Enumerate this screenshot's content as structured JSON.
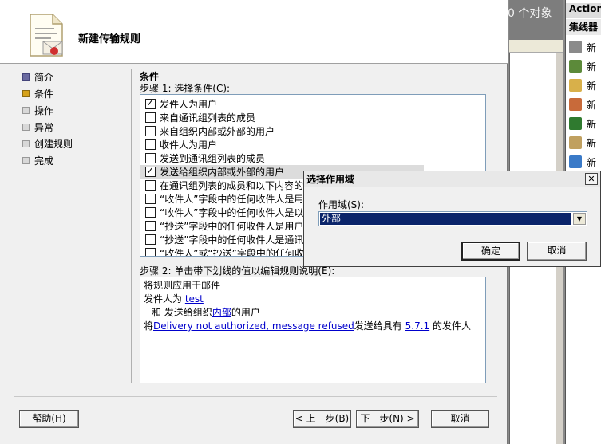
{
  "background": {
    "object_count_text": "0 个对象",
    "actions_header": "Actions",
    "actions_subheader": "集线器",
    "actions_items": [
      {
        "label": "新",
        "icon": "hub-icon",
        "color": "#8a8a8a"
      },
      {
        "label": "新",
        "icon": "connector-icon",
        "color": "#5c8a3a"
      },
      {
        "label": "新",
        "icon": "document-icon",
        "color": "#d8b04a"
      },
      {
        "label": "新",
        "icon": "mail-rule-icon",
        "color": "#c86a3a"
      },
      {
        "label": "新",
        "icon": "book-icon",
        "color": "#2f7a2f"
      },
      {
        "label": "新",
        "icon": "user-icon",
        "color": "#c0a060"
      },
      {
        "label": "新",
        "icon": "globe-icon",
        "color": "#3a7ac8"
      }
    ]
  },
  "wizard": {
    "title": "新建传输规则",
    "nav": [
      {
        "label": "简介",
        "state": "done"
      },
      {
        "label": "条件",
        "state": "current"
      },
      {
        "label": "操作",
        "state": "pending"
      },
      {
        "label": "异常",
        "state": "pending"
      },
      {
        "label": "创建规则",
        "state": "pending"
      },
      {
        "label": "完成",
        "state": "pending"
      }
    ],
    "conditions_heading": "条件",
    "step1_label": "步骤 1: 选择条件(C):",
    "conditions": [
      {
        "label": "发件人为用户",
        "checked": true
      },
      {
        "label": "来自通讯组列表的成员",
        "checked": false
      },
      {
        "label": "来自组织内部或外部的用户",
        "checked": false
      },
      {
        "label": "收件人为用户",
        "checked": false
      },
      {
        "label": "发送到通讯组列表的成员",
        "checked": false
      },
      {
        "label": "发送给组织内部或外部的用户",
        "checked": true,
        "selected": true
      },
      {
        "label": "在通讯组列表的成员和以下内容的",
        "checked": false
      },
      {
        "label": "“收件人”字段中的任何收件人是用",
        "checked": false
      },
      {
        "label": "“收件人”字段中的任何收件人是以",
        "checked": false
      },
      {
        "label": "“抄送”字段中的任何收件人是用户",
        "checked": false
      },
      {
        "label": "“抄送”字段中的任何收件人是通讯",
        "checked": false
      },
      {
        "label": "“收件人”或“抄送”字段中的任何收件",
        "checked": false
      }
    ],
    "step2_label": "步骤 2: 单击带下划线的值以编辑规则说明(E):",
    "description": {
      "line1": "将规则应用于邮件",
      "line2_prefix": "发件人为 ",
      "line2_link": "test",
      "line3_prefix": "和 发送给组织",
      "line3_link": "内部",
      "line3_suffix": "的用户",
      "line4_prefix": "将",
      "line4_link1": "Delivery not authorized, message refused",
      "line4_mid": "发送给具有 ",
      "line4_link2": "5.7.1",
      "line4_suffix": " 的发件人"
    },
    "buttons": {
      "help": "帮助(H)",
      "back": "< 上一步(B)",
      "next": "下一步(N) >",
      "cancel": "取消"
    }
  },
  "scope_dialog": {
    "title": "选择作用域",
    "field_label": "作用域(S):",
    "selected_value": "外部",
    "ok": "确定",
    "cancel": "取消"
  }
}
